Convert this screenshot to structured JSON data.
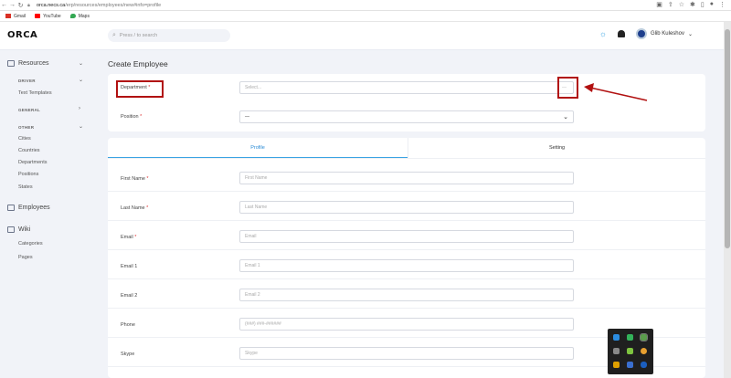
{
  "browser": {
    "url_host": "orca.necs.ca",
    "url_path": "/erp/resources/employees/new#info=profile",
    "bookmarks": [
      {
        "label": "Gmail"
      },
      {
        "label": "YouTube"
      },
      {
        "label": "Maps"
      }
    ]
  },
  "header": {
    "logo": "ORCA",
    "search_placeholder": "Press / to search",
    "user_name": "Glib Kuleshov"
  },
  "sidebar": {
    "resources_label": "Resources",
    "driver_group": "DRIVER",
    "text_templates": "Text Templates",
    "general_group": "GENERAL",
    "other_group": "OTHER",
    "other_items": [
      "Cities",
      "Countries",
      "Departments",
      "Positions",
      "States"
    ],
    "employees_label": "Employees",
    "wiki_label": "Wiki",
    "wiki_items": [
      "Categories",
      "Pages"
    ]
  },
  "page": {
    "title": "Create Employee",
    "department_label": "Department",
    "department_placeholder": "Select...",
    "department_dash": "—",
    "position_label": "Position",
    "position_value": "—",
    "required_mark": "*",
    "tabs": [
      "Profile",
      "Setting"
    ],
    "fields": [
      {
        "label": "First Name",
        "required": "*",
        "placeholder": "First Name"
      },
      {
        "label": "Last Name",
        "required": "*",
        "placeholder": "Last Name"
      },
      {
        "label": "Email",
        "required": "*",
        "placeholder": "Email"
      },
      {
        "label": "Email 1",
        "required": "",
        "placeholder": "Email 1"
      },
      {
        "label": "Email 2",
        "required": "",
        "placeholder": "Email 2"
      },
      {
        "label": "Phone",
        "required": "",
        "placeholder": "(###) ###-######"
      },
      {
        "label": "Skype",
        "required": "",
        "placeholder": "Skype"
      }
    ]
  },
  "colors": {
    "accent": "#2a8bd6",
    "annotation": "#b11010",
    "required": "#d33333"
  }
}
